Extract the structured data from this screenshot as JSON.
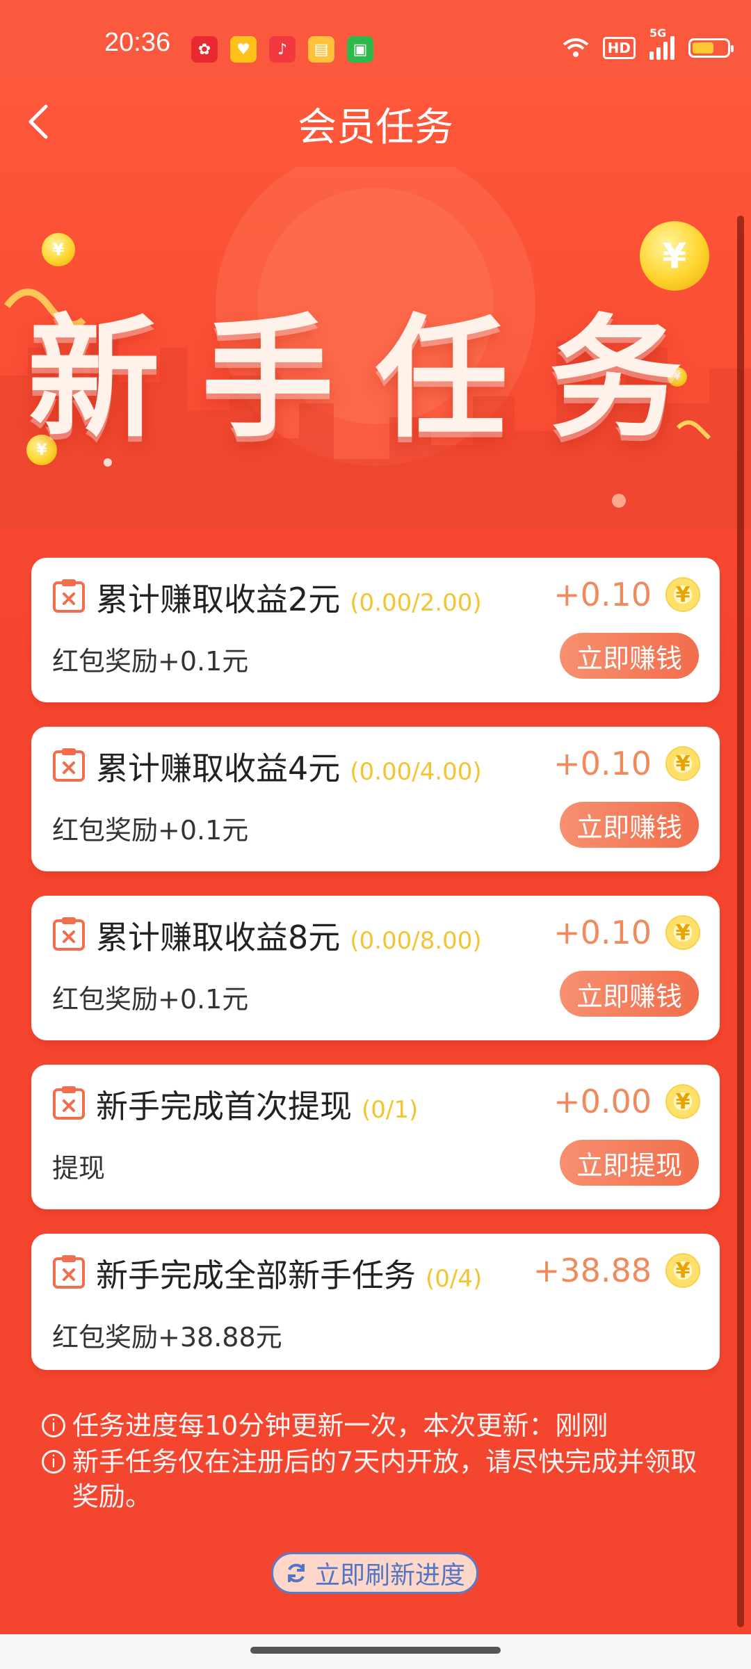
{
  "status_bar": {
    "time": "20:36",
    "hd": "HD",
    "net": "5G"
  },
  "header": {
    "title": "会员任务"
  },
  "banner": {
    "title": "新手任务"
  },
  "tasks": [
    {
      "name": "累计赚取收益2元",
      "progress": "(0.00/2.00)",
      "reward": "+0.10",
      "desc": "红包奖励+0.1元",
      "button": "立即赚钱"
    },
    {
      "name": "累计赚取收益4元",
      "progress": "(0.00/4.00)",
      "reward": "+0.10",
      "desc": "红包奖励+0.1元",
      "button": "立即赚钱"
    },
    {
      "name": "累计赚取收益8元",
      "progress": "(0.00/8.00)",
      "reward": "+0.10",
      "desc": "红包奖励+0.1元",
      "button": "立即赚钱"
    },
    {
      "name": "新手完成首次提现",
      "progress": "(0/1)",
      "reward": "+0.00",
      "desc": "提现",
      "button": "立即提现"
    },
    {
      "name": "新手完成全部新手任务",
      "progress": "(0/4)",
      "reward": "+38.88",
      "desc": "红包奖励+38.88元"
    }
  ],
  "notes": [
    "任务进度每10分钟更新一次，本次更新：刚刚",
    "新手任务仅在注册后的7天内开放，请尽快完成并领取奖励。"
  ],
  "refresh_button": "立即刷新进度",
  "colors": {
    "accent": "#f4462f",
    "button": "#f26d4b",
    "progress": "#f4c430",
    "reward": "#f08a5d"
  }
}
